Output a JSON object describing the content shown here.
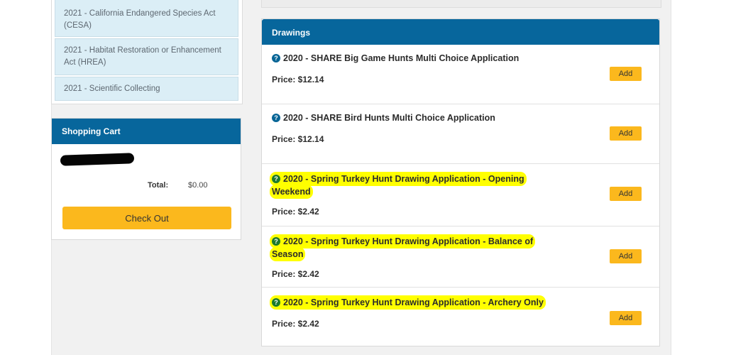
{
  "sidebar": {
    "items": [
      {
        "label": "2021 - California Endangered Species Act (CESA)"
      },
      {
        "label": "2021 - Habitat Restoration or Enhancement Act (HREA)"
      },
      {
        "label": "2021 - Scientific Collecting"
      }
    ]
  },
  "cart": {
    "title": "Shopping Cart",
    "total_label": "Total:",
    "total_value": "$0.00",
    "checkout_label": "Check Out"
  },
  "drawings": {
    "title": "Drawings",
    "add_label": "Add",
    "items": [
      {
        "title": "2020 - SHARE Big Game Hunts Multi Choice Application",
        "price": "Price: $12.14",
        "highlighted": false
      },
      {
        "title": "2020 - SHARE Bird Hunts Multi Choice Application",
        "price": "Price: $12.14",
        "highlighted": false
      },
      {
        "title": "2020 - Spring Turkey Hunt Drawing Application - Opening Weekend",
        "price": "Price: $2.42",
        "highlighted": true
      },
      {
        "title": "2020 - Spring Turkey Hunt Drawing Application - Balance of Season",
        "price": "Price: $2.42",
        "highlighted": true
      },
      {
        "title": "2020 - Spring Turkey Hunt Drawing Application - Archery Only",
        "price": "Price: $2.42",
        "highlighted": true
      }
    ]
  },
  "icons": {
    "info": "question-circle-icon",
    "info_glyph": "?"
  },
  "colors": {
    "header_blue": "#07669c",
    "button_yellow": "#fbb81d",
    "list_item_bg": "#dbeef6",
    "highlight": "#ffff00"
  }
}
